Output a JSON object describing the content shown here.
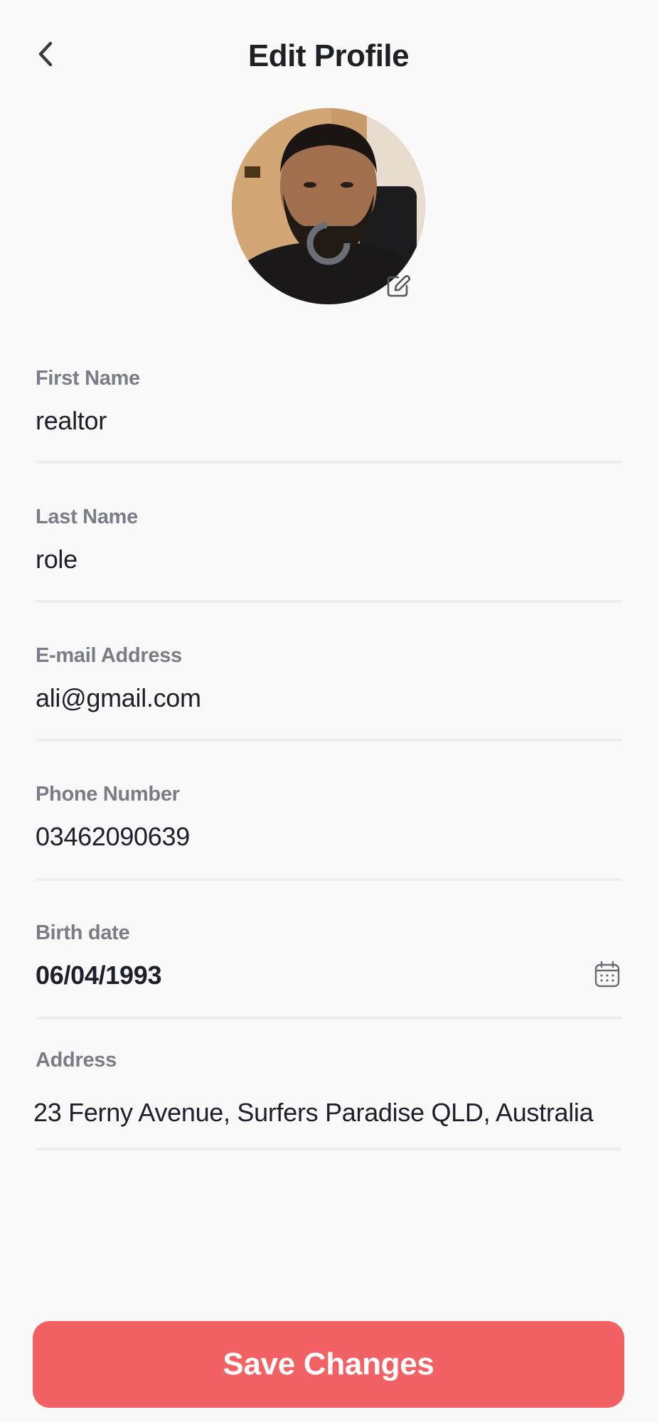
{
  "header": {
    "title": "Edit Profile",
    "back_icon": "chevron-left-icon"
  },
  "avatar": {
    "edit_icon": "edit-pencil-icon"
  },
  "form": {
    "first_name": {
      "label": "First Name",
      "value": "realtor"
    },
    "last_name": {
      "label": "Last Name",
      "value": "role"
    },
    "email": {
      "label": "E-mail Address",
      "value": "ali@gmail.com"
    },
    "phone": {
      "label": "Phone Number",
      "value": "03462090639"
    },
    "birth_date": {
      "label": "Birth date",
      "value": "06/04/1993",
      "icon": "calendar-icon"
    },
    "address": {
      "label": "Address",
      "value": "23 Ferny Avenue, Surfers Paradise QLD, Australia"
    }
  },
  "actions": {
    "save_label": "Save Changes"
  },
  "colors": {
    "accent": "#f26163",
    "label": "#7a7c86",
    "text": "#1e1f2a",
    "background": "#f9f9fa",
    "divider": "#eeeef1"
  }
}
